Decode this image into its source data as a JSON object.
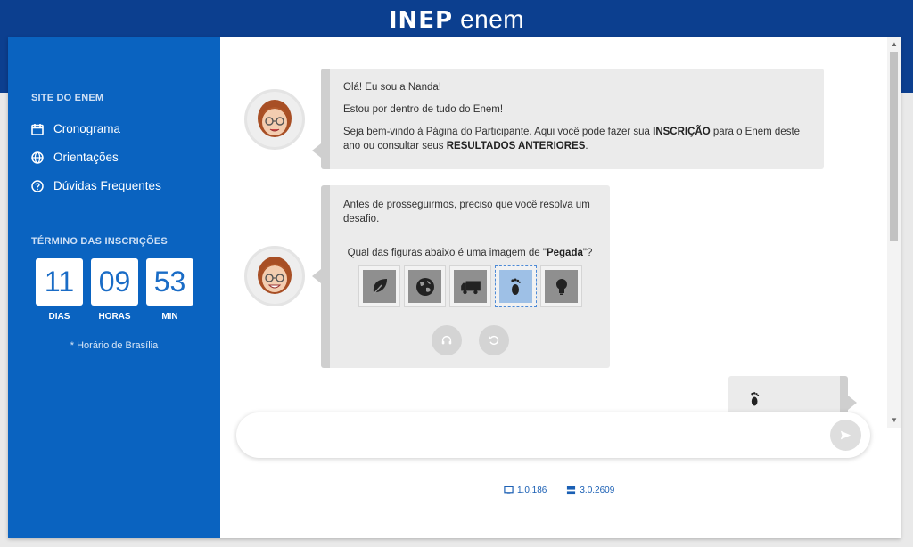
{
  "header": {
    "logo_inep": "INEP",
    "logo_enem": "enem"
  },
  "sidebar": {
    "site_heading": "SITE DO ENEM",
    "links": [
      {
        "label": "Cronograma",
        "icon": "calendar-icon"
      },
      {
        "label": "Orientações",
        "icon": "globe-icon"
      },
      {
        "label": "Dúvidas Frequentes",
        "icon": "question-circle-icon"
      }
    ],
    "countdown_heading": "TÉRMINO DAS INSCRIÇÕES",
    "countdown": [
      {
        "value": "11",
        "label": "DIAS"
      },
      {
        "value": "09",
        "label": "HORAS"
      },
      {
        "value": "53",
        "label": "MIN"
      }
    ],
    "timezone_note": "* Horário de Brasília"
  },
  "chat": {
    "message1": {
      "line1": "Olá! Eu sou a Nanda!",
      "line2": "Estou por dentro de tudo do Enem!",
      "line3_a": "Seja bem-vindo à Página do Participante. Aqui você pode fazer sua ",
      "line3_b": "INSCRIÇÃO",
      "line3_c": " para o Enem deste ano ou consultar seus ",
      "line3_d": "RESULTADOS ANTERIORES",
      "line3_e": "."
    },
    "message2": {
      "intro": "Antes de prosseguirmos, preciso que você resolva um desafio.",
      "question_a": "Qual das figuras abaixo é uma imagem de \"",
      "question_b": "Pegada",
      "question_c": "\"?",
      "options": [
        "leaf-icon",
        "globe-icon",
        "truck-icon",
        "footprint-icon",
        "lightbulb-icon"
      ],
      "selected_option": "footprint-icon"
    },
    "user_reply_icon": "footprint-icon"
  },
  "input": {
    "placeholder": ""
  },
  "footer": {
    "version_front": "1.0.186",
    "version_back": "3.0.2609"
  },
  "colors": {
    "brand_dark": "#0c3f8f",
    "sidebar_blue": "#0a63c0",
    "bubble": "#ebebeb"
  }
}
